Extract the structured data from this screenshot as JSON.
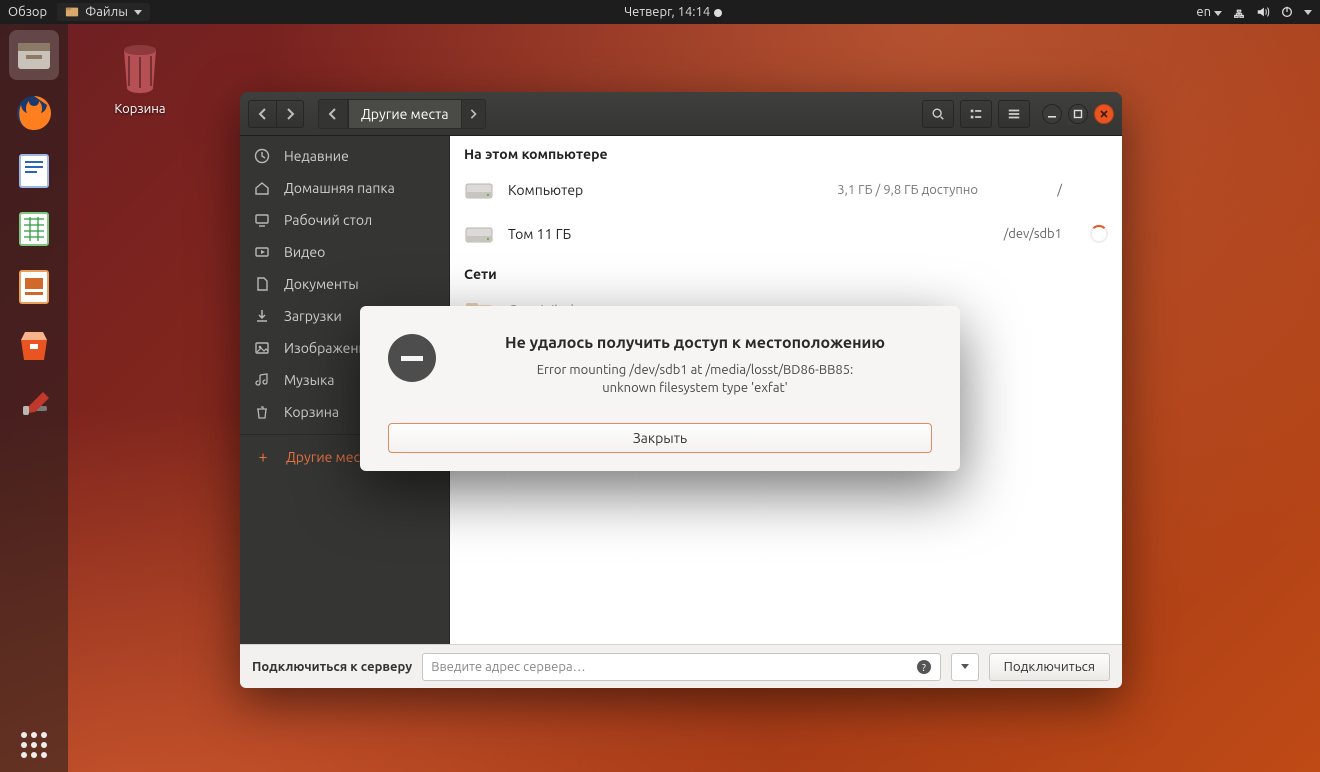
{
  "topbar": {
    "overview": "Обзор",
    "app_name": "Файлы",
    "clock": "Четверг, 14:14",
    "lang": "en"
  },
  "desktop": {
    "trash_label": "Корзина"
  },
  "window": {
    "path_active": "Другие места",
    "sidebar": [
      {
        "icon": "clock",
        "label": "Недавние"
      },
      {
        "icon": "home",
        "label": "Домашняя папка"
      },
      {
        "icon": "desktop",
        "label": "Рабочий стол"
      },
      {
        "icon": "video",
        "label": "Видео"
      },
      {
        "icon": "doc",
        "label": "Документы"
      },
      {
        "icon": "download",
        "label": "Загрузки"
      },
      {
        "icon": "image",
        "label": "Изображения"
      },
      {
        "icon": "music",
        "label": "Музыка"
      },
      {
        "icon": "trash",
        "label": "Корзина"
      }
    ],
    "sidebar_active": "Другие места",
    "sections": {
      "this_pc": "На этом компьютере",
      "networks": "Сети"
    },
    "drives": [
      {
        "name": "Компьютер",
        "meta": "3,1 ГБ / 9,8 ГБ доступно",
        "mount": "/",
        "loading": false
      },
      {
        "name": "Том 11 ГБ",
        "meta": "",
        "mount": "/dev/sdb1",
        "loading": true
      }
    ],
    "net_row": "Сеть Windows",
    "connect": {
      "label": "Подключиться к серверу",
      "placeholder": "Введите адрес сервера…",
      "button": "Подключиться"
    }
  },
  "dialog": {
    "title": "Не удалось получить доступ к местоположению",
    "line1": "Error mounting /dev/sdb1 at /media/losst/BD86-BB85:",
    "line2": "unknown filesystem type 'exfat'",
    "close": "Закрыть"
  }
}
